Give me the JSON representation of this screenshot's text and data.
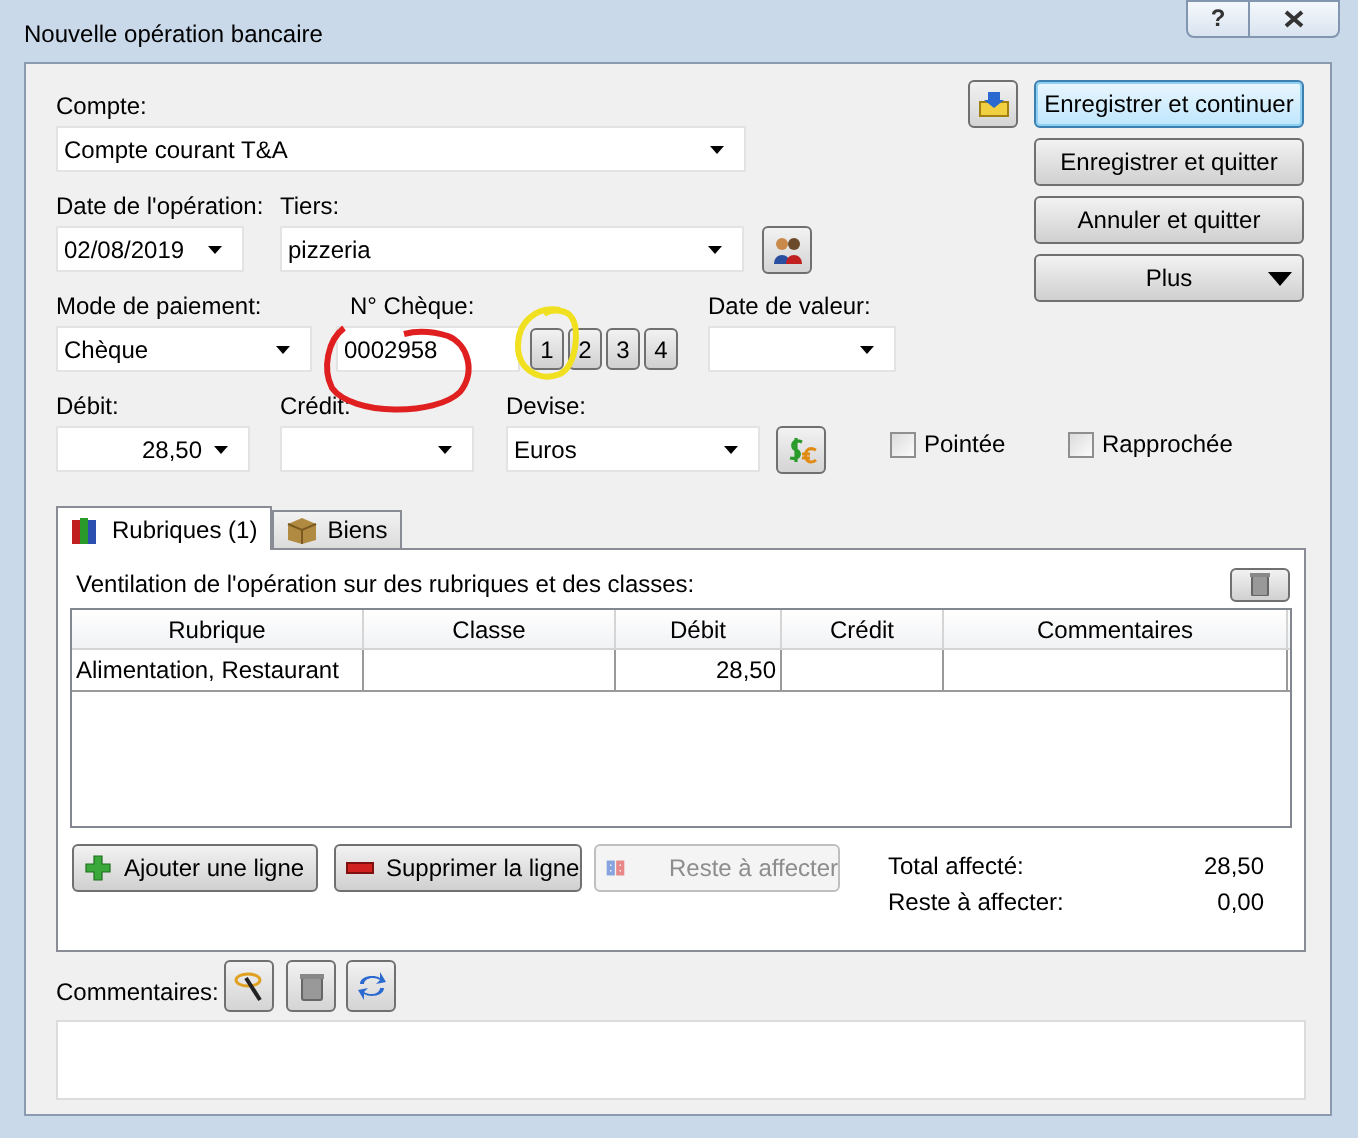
{
  "window": {
    "title": "Nouvelle opération bancaire",
    "help": "?"
  },
  "compte": {
    "label": "Compte:",
    "value": "Compte courant T&A"
  },
  "date_operation": {
    "label": "Date de l'opération:",
    "value": "02/08/2019"
  },
  "tiers": {
    "label": "Tiers:",
    "value": "pizzeria"
  },
  "mode_paiement": {
    "label": "Mode de paiement:",
    "value": "Chèque"
  },
  "numero_cheque": {
    "label": "N° Chèque:",
    "value": "0002958"
  },
  "cheque_buttons": [
    "1",
    "2",
    "3",
    "4"
  ],
  "date_valeur": {
    "label": "Date de valeur:"
  },
  "debit": {
    "label": "Débit:",
    "value": "28,50"
  },
  "credit": {
    "label": "Crédit:"
  },
  "devise": {
    "label": "Devise:",
    "value": "Euros"
  },
  "checkboxes": [
    {
      "label": "Pointée",
      "checked": false
    },
    {
      "label": "Rapprochée",
      "checked": false
    }
  ],
  "actions": [
    {
      "label": "Enregistrer et continuer",
      "kind": "default"
    },
    {
      "label": "Enregistrer et quitter",
      "kind": "plain"
    },
    {
      "label": "Annuler et quitter",
      "kind": "plain"
    },
    {
      "label": "Plus",
      "kind": "menu"
    }
  ],
  "tabs": [
    {
      "label": "Rubriques (1)",
      "selected": true
    },
    {
      "label": "Biens",
      "selected": false
    }
  ],
  "ventilation": {
    "label": "Ventilation de l'opération sur des rubriques et des classes:",
    "columns": [
      "Rubrique",
      "Classe",
      "Débit",
      "Crédit",
      "Commentaires"
    ],
    "rows": [
      [
        "Alimentation, Restaurant",
        "",
        "28,50",
        "",
        ""
      ]
    ],
    "buttons": [
      {
        "label": "Ajouter une ligne",
        "kind": "add",
        "disabled": false
      },
      {
        "label": "Supprimer la ligne",
        "kind": "remove",
        "disabled": false
      },
      {
        "label": "Reste à affecter",
        "kind": "split",
        "disabled": true
      }
    ],
    "totals": [
      {
        "label": "Total affecté:",
        "value": "28,50"
      },
      {
        "label": "Reste à affecter:",
        "value": "0,00"
      }
    ]
  },
  "commentaires": {
    "label": "Commentaires:"
  }
}
